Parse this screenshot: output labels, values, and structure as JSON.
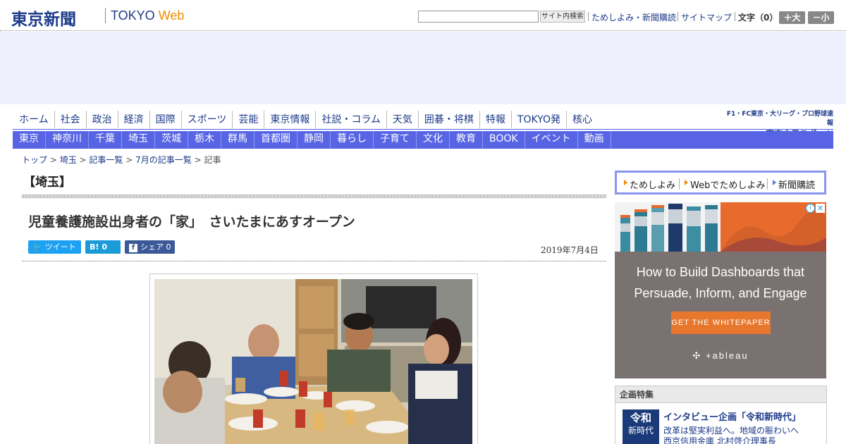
{
  "header": {
    "logo_jp": "東京新聞",
    "logo_en_1": "TOKYO ",
    "logo_en_2": "Web",
    "search_placeholder": "",
    "search_button": "サイト内検索",
    "links": [
      "ためしよみ・新聞購読",
      "サイトマップ"
    ],
    "font_label": "文字（0）",
    "font_up": "＋大",
    "font_down": "－小"
  },
  "nav_primary": [
    "ホーム",
    "社会",
    "政治",
    "経済",
    "国際",
    "スポーツ",
    "芸能",
    "東京情報",
    "社説・コラム",
    "天気",
    "囲碁・将棋",
    "特報",
    "TOKYO発",
    "核心"
  ],
  "chunichi": {
    "line1": "F1・FC東京・大リーグ・プロ野球速報",
    "line2": "東京中日スポーツ"
  },
  "nav_secondary": [
    "東京",
    "神奈川",
    "千葉",
    "埼玉",
    "茨城",
    "栃木",
    "群馬",
    "首都圏",
    "静岡",
    "暮らし",
    "子育て",
    "文化",
    "教育",
    "BOOK",
    "イベント",
    "動画"
  ],
  "breadcrumb": {
    "items": [
      "トップ",
      "埼玉",
      "記事一覧",
      "7月の記事一覧"
    ],
    "current": "記事",
    "sep": " > "
  },
  "section": {
    "title": "【埼玉】"
  },
  "article": {
    "title": "児童養護施設出身者の「家」　さいたまにあすオープン",
    "date": "2019年7月4日",
    "share": {
      "twitter_label": "ツイート",
      "hatena_label": "0",
      "facebook_label": "シェア 0"
    }
  },
  "sidebar": {
    "links": [
      "ためしよみ",
      "Webでためしよみ",
      "新聞購読"
    ],
    "ad": {
      "headline_1": "How to Build Dashboards that",
      "headline_2": "Persuade, Inform, and Engage",
      "cta": "GET THE WHITEPAPER",
      "brand": "+ableau"
    },
    "kikaku": {
      "heading": "企画特集",
      "thumb_1": "令和",
      "thumb_2": "新時代",
      "title": "インタビュー企画「令和新時代」",
      "text_1": "改革は堅実利益へ。地域の賑わいへ",
      "text_2": "西京信用金庫 北村啓介理事長"
    }
  },
  "colors": {
    "brand_navy": "#1d3a8a",
    "nav_blue": "#5765e5",
    "accent_orange": "#f08c00"
  }
}
